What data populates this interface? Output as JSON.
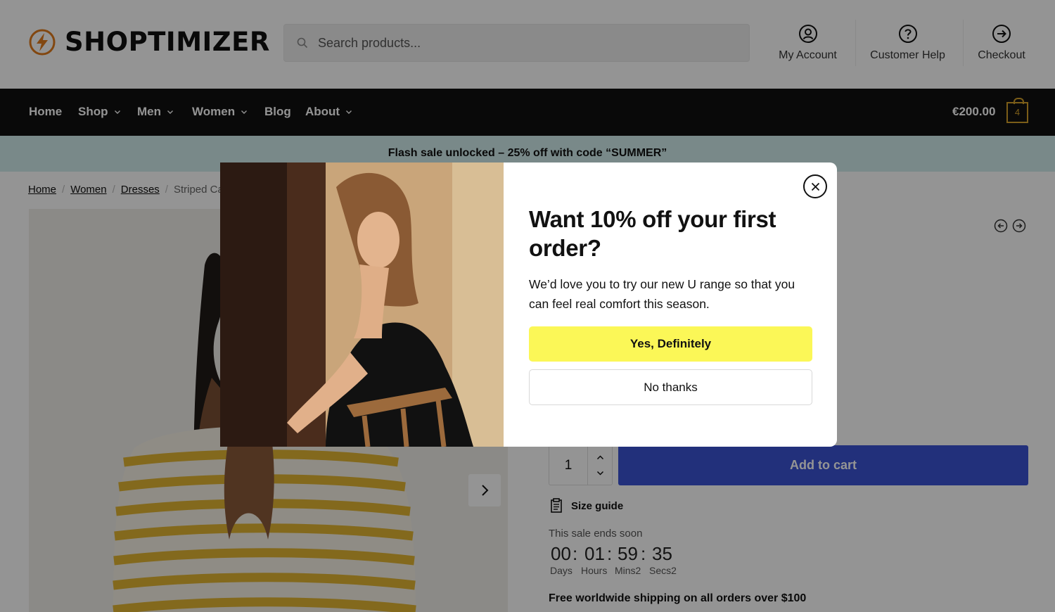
{
  "brand": {
    "name": "SHOPTIMIZER"
  },
  "search": {
    "placeholder": "Search products..."
  },
  "header_links": [
    {
      "label": "My Account",
      "icon": "user-circle-icon"
    },
    {
      "label": "Customer Help",
      "icon": "help-circle-icon"
    },
    {
      "label": "Checkout",
      "icon": "arrow-right-circle-icon"
    }
  ],
  "nav": {
    "items": [
      {
        "label": "Home",
        "dropdown": false
      },
      {
        "label": "Shop",
        "dropdown": true
      },
      {
        "label": "Men",
        "dropdown": true
      },
      {
        "label": "Women",
        "dropdown": true
      },
      {
        "label": "Blog",
        "dropdown": false
      },
      {
        "label": "About",
        "dropdown": true
      }
    ],
    "cart_total": "€200.00",
    "cart_count": "4"
  },
  "promo": {
    "text": "Flash sale unlocked – 25% off with code “SUMMER”"
  },
  "breadcrumb": {
    "items": [
      "Home",
      "Women",
      "Dresses"
    ],
    "current": "Striped Ca"
  },
  "product": {
    "quantity": "1",
    "add_to_cart": "Add to cart",
    "size_guide": "Size guide",
    "sale_ends": "This sale ends soon",
    "countdown": {
      "values": [
        "00",
        "01",
        "59",
        "35"
      ],
      "labels": [
        "Days",
        "Hours",
        "Mins2",
        "Secs2"
      ]
    },
    "shipping": "Free worldwide shipping on all orders over $100"
  },
  "modal": {
    "title": "Want 10% off your first order?",
    "text": "We’d love you to try our new U range so that you can feel real comfort this season.",
    "yes_label": "Yes, Definitely",
    "no_label": "No thanks"
  },
  "colors": {
    "accent_yellow": "#fbf757",
    "nav_bg": "#111111",
    "promo_bg": "#d0ecec",
    "add_to_cart_blue": "#3c54d4",
    "cart_gold": "#d4a12a",
    "logo_orange": "#e07a1c"
  }
}
